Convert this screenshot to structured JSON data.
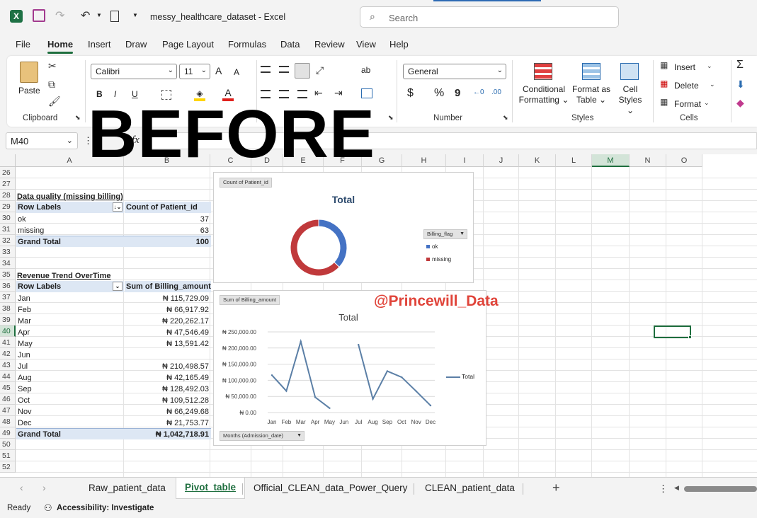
{
  "window": {
    "filename": "messy_healthcare_dataset",
    "app": "Excel",
    "title_sep": "-",
    "search_placeholder": "Search"
  },
  "menu_tabs": [
    "File",
    "Home",
    "Insert",
    "Draw",
    "Page Layout",
    "Formulas",
    "Data",
    "Review",
    "View",
    "Help"
  ],
  "active_tab": "Home",
  "ribbon": {
    "clipboard": {
      "paste": "Paste",
      "label": "Clipboard"
    },
    "font": {
      "name": "Calibri",
      "size": "11",
      "bold": "B",
      "italic": "I",
      "underline": "U",
      "grow": "A",
      "shrink": "A"
    },
    "alignment": {
      "wrap": "ab"
    },
    "number": {
      "format": "General",
      "label": "Number",
      "currency": "$",
      "percent": "%",
      "comma": "9"
    },
    "styles": {
      "conditional_1": "Conditional",
      "conditional_2": "Formatting",
      "format_table_1": "Format as",
      "format_table_2": "Table",
      "cell_styles_1": "Cell",
      "cell_styles_2": "Styles",
      "label": "Styles"
    },
    "cells": {
      "insert": "Insert",
      "delete": "Delete",
      "format": "Format",
      "label": "Cells"
    },
    "editing": {
      "sum": "Σ"
    }
  },
  "overlay": {
    "before": "BEFORE",
    "watermark": "@Princewill_Data"
  },
  "formula_bar": {
    "name_box": "M40",
    "fx": "fx",
    "value": ""
  },
  "columns": [
    "A",
    "B",
    "C",
    "D",
    "E",
    "F",
    "G",
    "H",
    "I",
    "J",
    "K",
    "L",
    "M",
    "N",
    "O"
  ],
  "selected_column": "M",
  "selected_row": "40",
  "rows": [
    "26",
    "27",
    "28",
    "29",
    "30",
    "31",
    "32",
    "33",
    "34",
    "35",
    "36",
    "37",
    "38",
    "39",
    "40",
    "41",
    "42",
    "43",
    "44",
    "45",
    "46",
    "47",
    "48",
    "49",
    "50",
    "51",
    "52"
  ],
  "pivot1": {
    "title": "Data quality (missing billing)",
    "header": [
      "Row Labels",
      "Count of Patient_id"
    ],
    "rows": [
      [
        "ok",
        "37"
      ],
      [
        "missing",
        "63"
      ]
    ],
    "total": [
      "Grand Total",
      "100"
    ]
  },
  "pivot2": {
    "title": "Revenue Trend OverTime",
    "header": [
      "Row Labels",
      "Sum of Billing_amount"
    ],
    "rows": [
      [
        "Jan",
        "₦ 115,729.09"
      ],
      [
        "Feb",
        "₦ 66,917.92"
      ],
      [
        "Mar",
        "₦ 220,262.17"
      ],
      [
        "Apr",
        "₦ 47,546.49"
      ],
      [
        "May",
        "₦ 13,591.42"
      ],
      [
        "Jun",
        ""
      ],
      [
        "Jul",
        "₦ 210,498.57"
      ],
      [
        "Aug",
        "₦ 42,165.49"
      ],
      [
        "Sep",
        "₦ 128,492.03"
      ],
      [
        "Oct",
        "₦ 109,512.28"
      ],
      [
        "Nov",
        "₦ 66,249.68"
      ],
      [
        "Dec",
        "₦ 21,753.77"
      ]
    ],
    "total": [
      "Grand Total",
      "₦ 1,042,718.91"
    ]
  },
  "chart_data": [
    {
      "type": "pie",
      "variant": "doughnut",
      "field_button": "Count of Patient_id",
      "title": "Total",
      "legend_field": "Billing_flag",
      "categories": [
        "ok",
        "missing"
      ],
      "values": [
        37,
        63
      ],
      "colors": [
        "#4472c4",
        "#c0393b"
      ],
      "legend": "right"
    },
    {
      "type": "line",
      "field_button": "Sum of Billing_amount",
      "title": "Total",
      "x": [
        "Jan",
        "Feb",
        "Mar",
        "Apr",
        "May",
        "Jun",
        "Jul",
        "Aug",
        "Sep",
        "Oct",
        "Nov",
        "Dec"
      ],
      "series": [
        {
          "name": "Total",
          "values": [
            115729.09,
            66917.92,
            220262.17,
            47546.49,
            13591.42,
            null,
            210498.57,
            42165.49,
            128492.03,
            109512.28,
            66249.68,
            21753.77
          ],
          "color": "#5b7fa6"
        }
      ],
      "y_ticks": [
        "₦ 250,000.00",
        "₦ 200,000.00",
        "₦ 150,000.00",
        "₦ 100,000.00",
        "₦ 50,000.00",
        "₦ 0.00"
      ],
      "ylim": [
        0,
        250000
      ],
      "grid": true,
      "legend": "right",
      "axis_field_button": "Months (Admission_date)"
    }
  ],
  "sheets": [
    "Raw_patient_data",
    "Pivot_table",
    "Official_CLEAN_data_Power_Query",
    "CLEAN_patient_data"
  ],
  "active_sheet": "Pivot_table",
  "status": {
    "ready": "Ready",
    "accessibility": "Accessibility: Investigate"
  }
}
